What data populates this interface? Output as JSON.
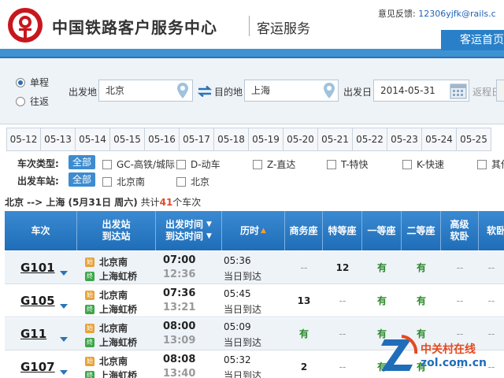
{
  "header": {
    "site_title": "中国铁路客户服务中心",
    "sub_title": "客运服务",
    "feedback_label": "意见反馈:",
    "feedback_email": "12306yjfk@rails.c",
    "nav_tab": "客运首页"
  },
  "search": {
    "trip_types": [
      "单程",
      "往返"
    ],
    "from_label": "出发地",
    "from_value": "北京",
    "to_label": "目的地",
    "to_value": "上海",
    "date_label": "出发日",
    "date_value": "2014-05-31",
    "return_label": "返程日"
  },
  "date_tabs": [
    "05-12",
    "05-13",
    "05-14",
    "05-15",
    "05-16",
    "05-17",
    "05-18",
    "05-19",
    "05-20",
    "05-21",
    "05-22",
    "05-23",
    "05-24",
    "05-25"
  ],
  "filters": {
    "type_label": "车次类型:",
    "all_label": "全部",
    "types": [
      "GC-高铁/城际",
      "D-动车",
      "Z-直达",
      "T-特快",
      "K-快速",
      "其他"
    ],
    "station_label": "出发车站:",
    "stations": [
      "北京南",
      "北京"
    ]
  },
  "summary": {
    "route": "北京 --> 上海 (5月31日 周六)",
    "count_prefix": "共计",
    "count": "41",
    "count_suffix": "个车次"
  },
  "table": {
    "headers": {
      "train": "车次",
      "stations_1": "出发站",
      "stations_2": "到达站",
      "time_1": "出发时间",
      "time_2": "到达时间",
      "duration": "历时",
      "business": "商务座",
      "special": "特等座",
      "first": "一等座",
      "second": "二等座",
      "soft_sleeper_1": "高级",
      "soft_sleeper_2": "软卧",
      "soft": "软卧"
    },
    "start_tag": "始",
    "end_tag": "终",
    "rows": [
      {
        "no": "G101",
        "from": "北京南",
        "to": "上海虹桥",
        "dep": "07:00",
        "arr": "12:36",
        "dur": "05:36",
        "arrive_day": "当日到达",
        "business": "--",
        "special": "12",
        "first": "有",
        "second": "有",
        "hs": "--",
        "soft": "--"
      },
      {
        "no": "G105",
        "from": "北京南",
        "to": "上海虹桥",
        "dep": "07:36",
        "arr": "13:21",
        "dur": "05:45",
        "arrive_day": "当日到达",
        "business": "13",
        "special": "--",
        "first": "有",
        "second": "有",
        "hs": "--",
        "soft": "--"
      },
      {
        "no": "G11",
        "from": "北京南",
        "to": "上海虹桥",
        "dep": "08:00",
        "arr": "13:09",
        "dur": "05:09",
        "arrive_day": "当日到达",
        "business": "有",
        "special": "--",
        "first": "有",
        "second": "有",
        "hs": "--",
        "soft": "--"
      },
      {
        "no": "G107",
        "from": "北京南",
        "to": "上海虹桥",
        "dep": "08:08",
        "arr": "13:40",
        "dur": "05:32",
        "arrive_day": "当日到达",
        "business": "2",
        "special": "--",
        "first": "有",
        "second": "有",
        "hs": "--",
        "soft": "--"
      }
    ]
  },
  "watermark": {
    "cn": "中关村在线",
    "en": "zol.com.cn"
  },
  "colors": {
    "accent": "#2a74b7",
    "has_ticket": "#2a8a2a",
    "highlight": "#e24b2b"
  }
}
